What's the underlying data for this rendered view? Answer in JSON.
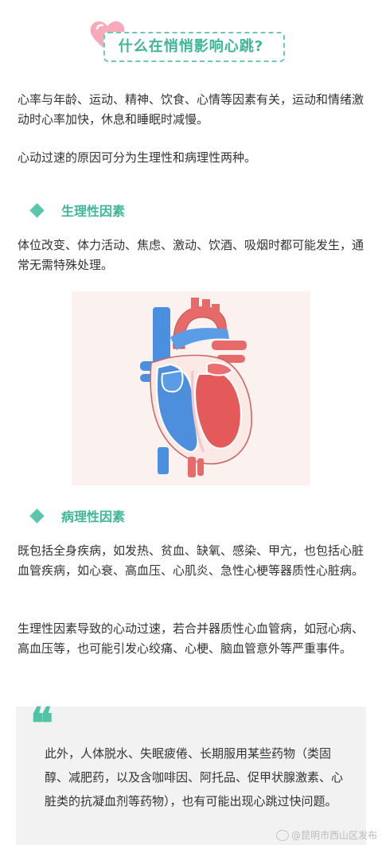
{
  "title": "什么在悄悄影响心跳?",
  "intro": {
    "p1": "心率与年龄、运动、精神、饮食、心情等因素有关，运动和情绪激动时心率加快，休息和睡眠时减慢。",
    "p2": "心动过速的原因可分为生理性和病理性两种。"
  },
  "physiological": {
    "heading": "生理性因素",
    "text": "体位改变、体力活动、焦虑、激动、饮酒、吸烟时都可能发生，通常无需特殊处理。"
  },
  "pathological": {
    "heading": "病理性因素",
    "text1": "既包括全身疾病，如发热、贫血、缺氧、感染、甲亢，也包括心脏血管疾病，如心衰、高血压、心肌炎、急性心梗等器质性心脏病。",
    "text2": "生理性因素导致的心动过速，若合并器质性心血管病，如冠心病、高血压等，也可能引发心绞痛、心梗、脑血管意外等严重事件。"
  },
  "quote": {
    "mark": "❝",
    "text": "此外，人体脱水、失眠疲倦、长期服用某些药物（类固醇、减肥药，以及含咖啡因、阿托品、促甲状腺激素、心脏类的抗凝血剂等药物），也有可能出现心跳过快问题。"
  },
  "watermark": "@昆明市西山区发布",
  "colors": {
    "accent": "#3fb699",
    "heart_pink": "#f4a3b3",
    "vein_blue": "#4a90e2",
    "artery_red": "#e65b5b"
  },
  "icons": {
    "title_decoration": "heart-icon",
    "section_marker": "diamond-icon"
  }
}
